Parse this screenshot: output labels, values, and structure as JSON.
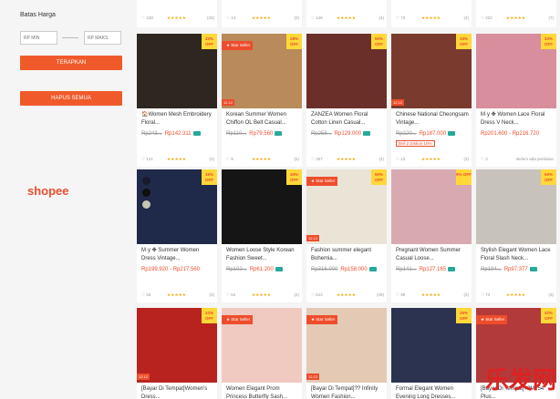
{
  "filter": {
    "title": "Batas Harga",
    "min_placeholder": "RP MIN",
    "max_placeholder": "RP MAKS",
    "apply_label": "TERAPKAN",
    "clear_label": "HAPUS SEMUA"
  },
  "logo_text": "shopee",
  "products": [
    {
      "name": "🏠Women Mesh Embroidery Floral...",
      "old_price": "Rp243...",
      "price": "Rp142.311",
      "sold": "(4)",
      "likes": "121",
      "badge": "33% OFF",
      "star_seller": false,
      "date_tag": "",
      "img_color": "#2e2620"
    },
    {
      "name": "Korean Summer Women Chiffon OL Belt Casual...",
      "old_price": "Rp110...",
      "price": "Rp79.560",
      "sold": "(5)",
      "likes": "9",
      "badge": "28% OFF",
      "star_seller": true,
      "date_tag": "12.12",
      "img_color": "#b98a5a"
    },
    {
      "name": "ZANZEA Women Floral Cotton Linen Casual...",
      "old_price": "Rp258...",
      "price": "Rp129.000",
      "sold": "(4)",
      "likes": "467",
      "badge": "50% OFF",
      "star_seller": false,
      "date_tag": "",
      "img_color": "#6b2f2a"
    },
    {
      "name": "Chinese National Cheongsam Vintage...",
      "old_price": "Rp220...",
      "price": "Rp187.000",
      "sold": "(4)",
      "likes": "13",
      "badge": "15% OFF",
      "star_seller": false,
      "date_tag": "12.12",
      "img_color": "#7a3b2e",
      "promo": "Beli 2 Diskon 10%"
    },
    {
      "name": "M·y ✤ Women Lace Floral Dress V Neck...",
      "old_price": "",
      "price": "Rp201.600 - Rp216.720",
      "sold": "Belum ada penilaian",
      "likes": "3",
      "badge": "33% OFF",
      "star_seller": false,
      "date_tag": "",
      "img_color": "#d88e9c"
    },
    {
      "name": "M·y ✤ Summer Women Dress Vintage...",
      "old_price": "",
      "price": "Rp199.920 - Rp217.560",
      "sold": "(2)",
      "likes": "25",
      "badge": "15% OFF",
      "star_seller": false,
      "date_tag": "",
      "img_color": "#1f2a4a"
    },
    {
      "name": "Women Loose Style Korean Fashion Sweet...",
      "old_price": "Rp102...",
      "price": "Rp61.200",
      "sold": "(2)",
      "likes": "64",
      "badge": "40% OFF",
      "star_seller": false,
      "date_tag": "",
      "img_color": "#151515"
    },
    {
      "name": "Fashion summer elegant Bohemia...",
      "old_price": "Rp316.000",
      "price": "Rp158.000",
      "sold": "(29)",
      "likes": "612",
      "badge": "50% OFF",
      "star_seller": true,
      "date_tag": "12.12",
      "img_color": "#e9e4d6"
    },
    {
      "name": "Pregnant Women Summer Casual Loose...",
      "old_price": "Rp141...",
      "price": "Rp127.165",
      "sold": "(2)",
      "likes": "99",
      "badge": "9% OFF",
      "star_seller": false,
      "date_tag": "",
      "img_color": "#d9a9b2"
    },
    {
      "name": "Stylish Elegant Women Lace Floral Slash Neck...",
      "old_price": "Rp194...",
      "price": "Rp97.377",
      "sold": "(3)",
      "likes": "73",
      "badge": "50% OFF",
      "star_seller": false,
      "date_tag": "",
      "img_color": "#c7c2bb"
    },
    {
      "name": "[Bayar Di Tempat]Women's Dress...",
      "old_price": "",
      "price": "",
      "sold": "",
      "likes": "",
      "badge": "22% OFF",
      "star_seller": false,
      "date_tag": "12.12",
      "img_color": "#b8231f"
    },
    {
      "name": "Women Elegant Prom Princess Butterfly Sash...",
      "old_price": "",
      "price": "",
      "sold": "",
      "likes": "",
      "badge": "",
      "star_seller": true,
      "date_tag": "",
      "img_color": "#f0c9c0"
    },
    {
      "name": "[Bayar Di Tempat]?? Infinity Women Fashion...",
      "old_price": "",
      "price": "",
      "sold": "",
      "likes": "",
      "badge": "",
      "star_seller": true,
      "date_tag": "12.12",
      "img_color": "#e4c9b4"
    },
    {
      "name": "Formal Elegant Women Evening Long Dresses...",
      "old_price": "",
      "price": "",
      "sold": "",
      "likes": "",
      "badge": "25% OFF",
      "star_seller": false,
      "date_tag": "",
      "img_color": "#2b3350"
    },
    {
      "name": "[Bayar Di Tempat]??M?54 Plus...",
      "old_price": "",
      "price": "",
      "sold": "",
      "likes": "",
      "badge": "42% OFF",
      "star_seller": true,
      "date_tag": "",
      "img_color": "#b33a3a"
    }
  ],
  "top_row": [
    {
      "sold": "(33)",
      "likes": "228"
    },
    {
      "sold": "(2)",
      "likes": "14"
    },
    {
      "sold": "(4)",
      "likes": "146"
    },
    {
      "sold": "(4)",
      "likes": "73"
    },
    {
      "sold": "(7)",
      "likes": "222"
    }
  ],
  "stars": "★★★★★",
  "watermark": "乐发网",
  "watermark_sub": "知乎 @李文浩"
}
